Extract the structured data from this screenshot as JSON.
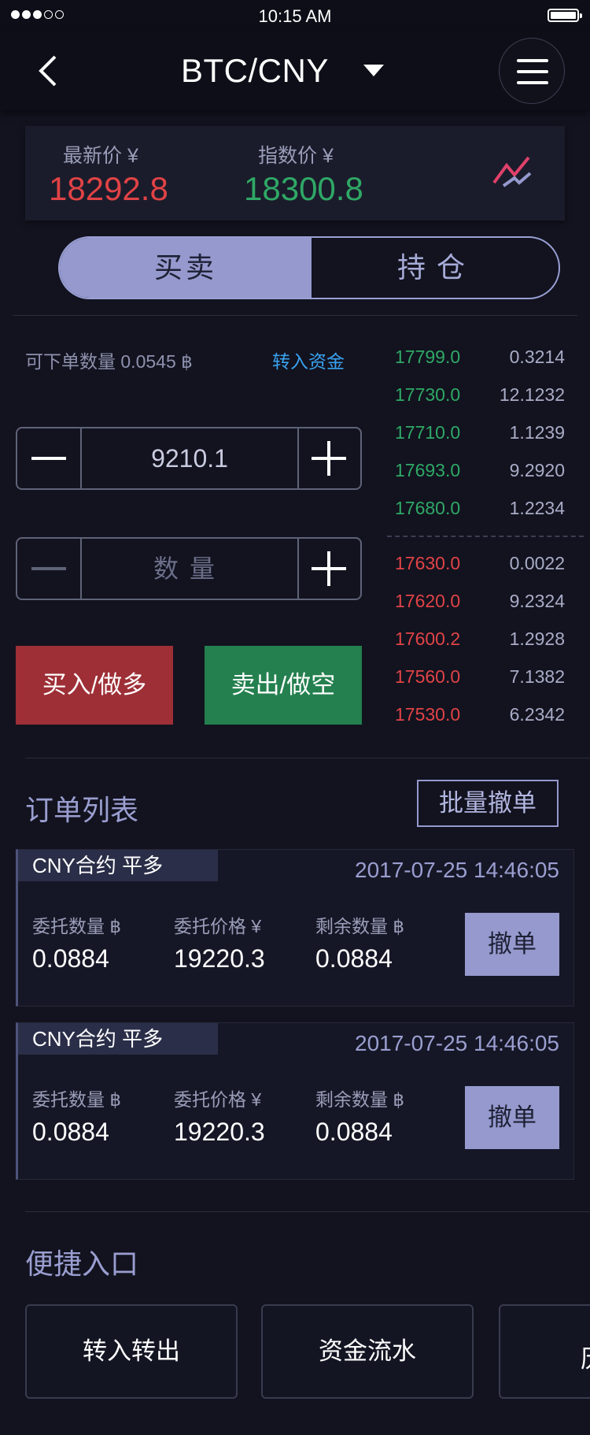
{
  "status_bar": {
    "time": "10:15 AM"
  },
  "nav": {
    "title": "BTC/CNY"
  },
  "price": {
    "last_label": "最新价 ¥",
    "last_value": "18292.8",
    "index_label": "指数价 ¥",
    "index_value": "18300.8"
  },
  "tabs": {
    "trade": "买卖",
    "position": "持仓"
  },
  "form": {
    "available_label": "可下单数量 0.0545 ฿",
    "transfer_link": "转入资金",
    "price_value": "9210.1",
    "quantity_placeholder": "数量",
    "buy_label": "买入/做多",
    "sell_label": "卖出/做空"
  },
  "order_book": {
    "asks": [
      {
        "price": "17799.0",
        "qty": "0.3214"
      },
      {
        "price": "17730.0",
        "qty": "12.1232"
      },
      {
        "price": "17710.0",
        "qty": "1.1239"
      },
      {
        "price": "17693.0",
        "qty": "9.2920"
      },
      {
        "price": "17680.0",
        "qty": "1.2234"
      }
    ],
    "bids": [
      {
        "price": "17630.0",
        "qty": "0.0022"
      },
      {
        "price": "17620.0",
        "qty": "9.2324"
      },
      {
        "price": "17600.2",
        "qty": "1.2928"
      },
      {
        "price": "17560.0",
        "qty": "7.1382"
      },
      {
        "price": "17530.0",
        "qty": "6.2342"
      }
    ],
    "colors": {
      "ask": "#2fa866",
      "bid": "#e04346"
    }
  },
  "orders": {
    "title": "订单列表",
    "batch_cancel": "批量撤单",
    "items": [
      {
        "tag": "CNY合约  平多",
        "datetime": "2017-07-25 14:46:05",
        "qty_label": "委托数量 ฿",
        "qty": "0.0884",
        "price_label": "委托价格 ¥",
        "price": "19220.3",
        "remain_label": "剩余数量 ฿",
        "remain": "0.0884",
        "cancel": "撤单"
      },
      {
        "tag": "CNY合约  平多",
        "datetime": "2017-07-25 14:46:05",
        "qty_label": "委托数量 ฿",
        "qty": "0.0884",
        "price_label": "委托价格 ¥",
        "price": "19220.3",
        "remain_label": "剩余数量 ฿",
        "remain": "0.0884",
        "cancel": "撤单"
      }
    ]
  },
  "quick": {
    "title": "便捷入口",
    "items": [
      "转入转出",
      "资金流水",
      "历史"
    ]
  },
  "icons": [
    "back-chevron-icon",
    "dropdown-caret-icon",
    "menu-icon",
    "trend-chart-icon",
    "minus-icon",
    "plus-icon"
  ]
}
